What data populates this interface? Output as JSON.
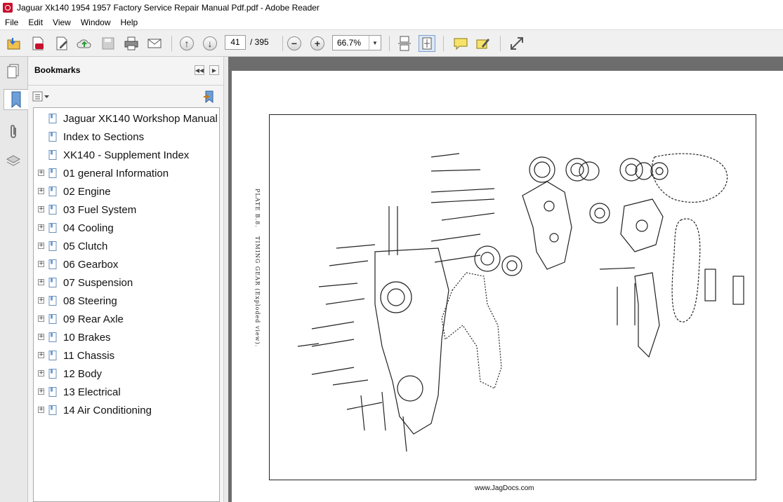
{
  "window": {
    "title": "Jaguar Xk140 1954 1957 Factory Service Repair Manual Pdf.pdf - Adobe Reader"
  },
  "menu": {
    "items": [
      "File",
      "Edit",
      "View",
      "Window",
      "Help"
    ]
  },
  "toolbar": {
    "page_current": "41",
    "page_total": "/ 395",
    "zoom": "66.7%"
  },
  "bookmarks_panel": {
    "title": "Bookmarks",
    "items": [
      {
        "label": "Jaguar XK140 Workshop Manual",
        "expandable": false
      },
      {
        "label": "Index to Sections",
        "expandable": false
      },
      {
        "label": "XK140 - Supplement Index",
        "expandable": false
      },
      {
        "label": "01 general Information",
        "expandable": true
      },
      {
        "label": "02 Engine",
        "expandable": true
      },
      {
        "label": "03 Fuel System",
        "expandable": true
      },
      {
        "label": "04 Cooling",
        "expandable": true
      },
      {
        "label": "05 Clutch",
        "expandable": true
      },
      {
        "label": "06 Gearbox",
        "expandable": true
      },
      {
        "label": "07 Suspension",
        "expandable": true
      },
      {
        "label": "08 Steering",
        "expandable": true
      },
      {
        "label": "09 Rear Axle",
        "expandable": true
      },
      {
        "label": "10 Brakes",
        "expandable": true
      },
      {
        "label": "11 Chassis",
        "expandable": true
      },
      {
        "label": "12 Body",
        "expandable": true
      },
      {
        "label": "13 Electrical",
        "expandable": true
      },
      {
        "label": "14 Air Conditioning",
        "expandable": true
      }
    ]
  },
  "document": {
    "plate_label": "PLATE B.8.",
    "caption": "TIMING GEAR (Exploded view).",
    "footer": "www.JagDocs.com"
  }
}
